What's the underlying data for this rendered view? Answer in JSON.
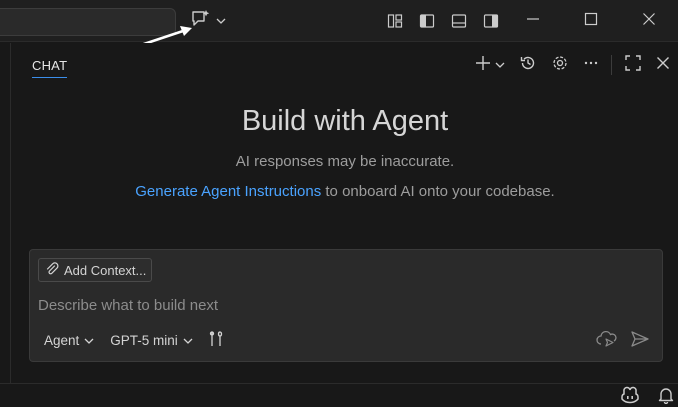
{
  "titlebar": {
    "icons": [
      "chat-sparkle-icon",
      "chevron-down-icon",
      "customize-layout-icon",
      "toggle-primary-sidebar-icon",
      "toggle-panel-icon",
      "toggle-secondary-sidebar-icon"
    ],
    "window_controls": [
      "minimize-icon",
      "maximize-icon",
      "close-icon"
    ]
  },
  "panel": {
    "tab_label": "CHAT",
    "actions": [
      "new-chat-icon",
      "chevron-down-icon",
      "history-icon",
      "settings-icon",
      "more-icon",
      "maximize-panel-icon",
      "close-panel-icon"
    ]
  },
  "welcome": {
    "title": "Build with Agent",
    "disclaimer": "AI responses may be inaccurate.",
    "link_text": "Generate Agent Instructions",
    "link_suffix": " to onboard AI onto your codebase."
  },
  "input": {
    "add_context_label": "Add Context...",
    "placeholder": "Describe what to build next",
    "mode_label": "Agent",
    "model_label": "GPT-5 mini"
  },
  "colors": {
    "background": "#181818",
    "input_background": "#2a2a2a",
    "link": "#4aa3ff",
    "tab_underline": "#3b8eea"
  }
}
